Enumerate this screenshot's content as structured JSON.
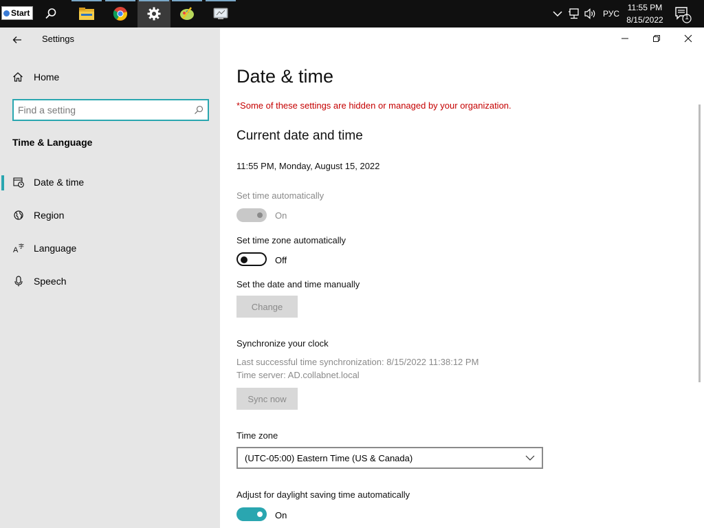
{
  "taskbar": {
    "start_label": "Start",
    "language": "РУС",
    "clock_time": "11:55 PM",
    "clock_date": "8/15/2022",
    "notification_count": "1"
  },
  "window": {
    "app_title": "Settings"
  },
  "sidebar": {
    "home_label": "Home",
    "search_placeholder": "Find a setting",
    "section_title": "Time & Language",
    "items": [
      {
        "label": "Date & time",
        "icon": "calendar-clock-icon",
        "selected": true
      },
      {
        "label": "Region",
        "icon": "globe-icon",
        "selected": false
      },
      {
        "label": "Language",
        "icon": "language-icon",
        "selected": false
      },
      {
        "label": "Speech",
        "icon": "microphone-icon",
        "selected": false
      }
    ]
  },
  "main": {
    "title": "Date & time",
    "managed_warning": "*Some of these settings are hidden or managed by your organization.",
    "current_heading": "Current date and time",
    "current_datetime": "11:55 PM, Monday, August 15, 2022",
    "set_time_auto": {
      "label": "Set time automatically",
      "state": "On",
      "enabled": false
    },
    "set_tz_auto": {
      "label": "Set time zone automatically",
      "state": "Off"
    },
    "manual": {
      "label": "Set the date and time manually",
      "button": "Change"
    },
    "sync": {
      "heading": "Synchronize your clock",
      "last_sync": "Last successful time synchronization: 8/15/2022 11:38:12 PM",
      "server": "Time server: AD.collabnet.local",
      "button": "Sync now"
    },
    "timezone": {
      "label": "Time zone",
      "value": "(UTC-05:00) Eastern Time (US & Canada)"
    },
    "dst": {
      "label": "Adjust for daylight saving time automatically",
      "state": "On"
    }
  },
  "colors": {
    "accent": "#2aa6b0",
    "warning": "#c50000",
    "sidebar_bg": "#e6e6e6",
    "taskbar_bg": "#101010"
  }
}
